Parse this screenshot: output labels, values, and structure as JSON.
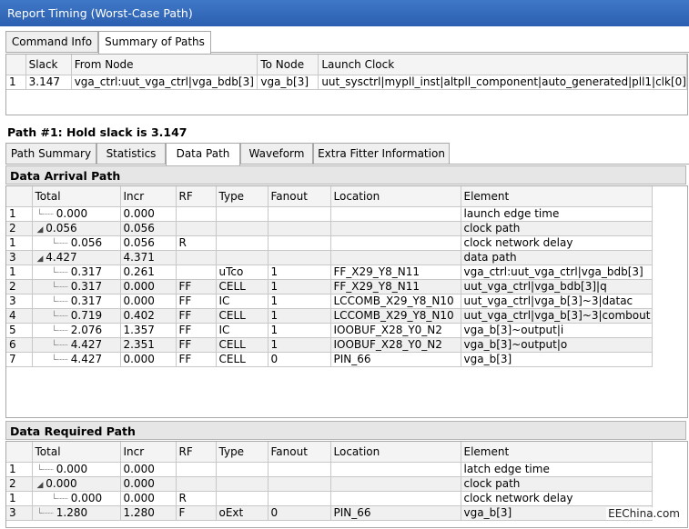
{
  "window": {
    "title": "Report Timing (Worst-Case Path)"
  },
  "top_tabs": [
    {
      "label": "Command Info",
      "active": false
    },
    {
      "label": "Summary of Paths",
      "active": true
    }
  ],
  "summary_table": {
    "columns": [
      "",
      "Slack",
      "From Node",
      "To Node",
      "Launch Clock"
    ],
    "rows": [
      [
        "1",
        "3.147",
        "vga_ctrl:uut_vga_ctrl|vga_bdb[3]",
        "vga_b[3]",
        "uut_sysctrl|mypll_inst|altpll_component|auto_generated|pll1|clk[0]"
      ]
    ]
  },
  "path_title": "Path #1: Hold slack is 3.147",
  "detail_tabs": [
    {
      "label": "Path Summary",
      "active": false
    },
    {
      "label": "Statistics",
      "active": false
    },
    {
      "label": "Data Path",
      "active": true
    },
    {
      "label": "Waveform",
      "active": false
    },
    {
      "label": "Extra Fitter Information",
      "active": false
    }
  ],
  "arrival": {
    "header": "Data Arrival Path",
    "columns": [
      "",
      "Total",
      "Incr",
      "RF",
      "Type",
      "Fanout",
      "Location",
      "Element"
    ],
    "rows": [
      {
        "c0": "1",
        "indent": 1,
        "tree": "line",
        "total": "0.000",
        "incr": "0.000",
        "rf": "",
        "type": "",
        "fanout": "",
        "location": "",
        "element": "launch edge time"
      },
      {
        "c0": "2",
        "indent": 1,
        "tree": "expand",
        "total": "0.056",
        "incr": "0.056",
        "rf": "",
        "type": "",
        "fanout": "",
        "location": "",
        "element": "clock path"
      },
      {
        "c0": "1",
        "indent": 2,
        "tree": "line",
        "total": "0.056",
        "incr": "0.056",
        "rf": "R",
        "type": "",
        "fanout": "",
        "location": "",
        "element": "clock network delay"
      },
      {
        "c0": "3",
        "indent": 1,
        "tree": "expand",
        "total": "4.427",
        "incr": "4.371",
        "rf": "",
        "type": "",
        "fanout": "",
        "location": "",
        "element": "data path"
      },
      {
        "c0": "1",
        "indent": 2,
        "tree": "line",
        "total": "0.317",
        "incr": "0.261",
        "rf": "",
        "type": "uTco",
        "fanout": "1",
        "location": "FF_X29_Y8_N11",
        "element": "vga_ctrl:uut_vga_ctrl|vga_bdb[3]"
      },
      {
        "c0": "2",
        "indent": 2,
        "tree": "line",
        "total": "0.317",
        "incr": "0.000",
        "rf": "FF",
        "type": "CELL",
        "fanout": "1",
        "location": "FF_X29_Y8_N11",
        "element": "uut_vga_ctrl|vga_bdb[3]|q"
      },
      {
        "c0": "3",
        "indent": 2,
        "tree": "line",
        "total": "0.317",
        "incr": "0.000",
        "rf": "FF",
        "type": "IC",
        "fanout": "1",
        "location": "LCCOMB_X29_Y8_N10",
        "element": "uut_vga_ctrl|vga_b[3]~3|datac"
      },
      {
        "c0": "4",
        "indent": 2,
        "tree": "line",
        "total": "0.719",
        "incr": "0.402",
        "rf": "FF",
        "type": "CELL",
        "fanout": "1",
        "location": "LCCOMB_X29_Y8_N10",
        "element": "uut_vga_ctrl|vga_b[3]~3|combout"
      },
      {
        "c0": "5",
        "indent": 2,
        "tree": "line",
        "total": "2.076",
        "incr": "1.357",
        "rf": "FF",
        "type": "IC",
        "fanout": "1",
        "location": "IOOBUF_X28_Y0_N2",
        "element": "vga_b[3]~output|i"
      },
      {
        "c0": "6",
        "indent": 2,
        "tree": "line",
        "total": "4.427",
        "incr": "2.351",
        "rf": "FF",
        "type": "CELL",
        "fanout": "1",
        "location": "IOOBUF_X28_Y0_N2",
        "element": "vga_b[3]~output|o"
      },
      {
        "c0": "7",
        "indent": 2,
        "tree": "line",
        "total": "4.427",
        "incr": "0.000",
        "rf": "FF",
        "type": "CELL",
        "fanout": "0",
        "location": "PIN_66",
        "element": "vga_b[3]"
      }
    ]
  },
  "required": {
    "header": "Data Required Path",
    "columns": [
      "",
      "Total",
      "Incr",
      "RF",
      "Type",
      "Fanout",
      "Location",
      "Element"
    ],
    "rows": [
      {
        "c0": "1",
        "indent": 1,
        "tree": "line",
        "total": "0.000",
        "incr": "0.000",
        "rf": "",
        "type": "",
        "fanout": "",
        "location": "",
        "element": "latch edge time"
      },
      {
        "c0": "2",
        "indent": 1,
        "tree": "expand",
        "total": "0.000",
        "incr": "0.000",
        "rf": "",
        "type": "",
        "fanout": "",
        "location": "",
        "element": "clock path"
      },
      {
        "c0": "1",
        "indent": 2,
        "tree": "line",
        "total": "0.000",
        "incr": "0.000",
        "rf": "R",
        "type": "",
        "fanout": "",
        "location": "",
        "element": "clock network delay"
      },
      {
        "c0": "3",
        "indent": 1,
        "tree": "line",
        "total": "1.280",
        "incr": "1.280",
        "rf": "F",
        "type": "oExt",
        "fanout": "0",
        "location": "PIN_66",
        "element": "vga_b[3]"
      }
    ]
  },
  "watermark": "EEChina.com"
}
